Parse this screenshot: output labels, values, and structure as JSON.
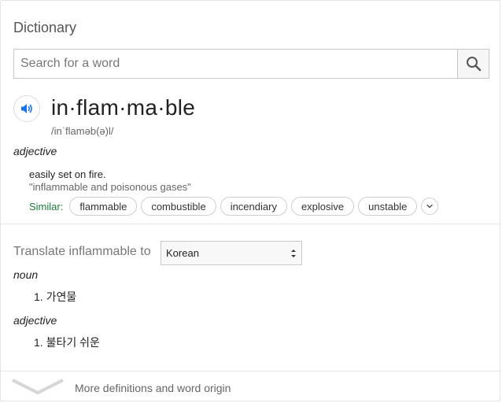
{
  "panel": {
    "title": "Dictionary"
  },
  "search": {
    "placeholder": "Search for a word"
  },
  "entry": {
    "headword": "in·flam·ma·ble",
    "phonetic": "/inˈflaməb(ə)l/",
    "part_of_speech": "adjective",
    "definition": "easily set on fire.",
    "example": "\"inflammable and poisonous gases\"",
    "similar_label": "Similar:",
    "similar": [
      "flammable",
      "combustible",
      "incendiary",
      "explosive",
      "unstable"
    ]
  },
  "translate": {
    "label": "Translate inflammable to",
    "language": "Korean",
    "groups": [
      {
        "pos": "noun",
        "items": [
          "1. 가연물"
        ]
      },
      {
        "pos": "adjective",
        "items": [
          "1. 불타기 쉬운"
        ]
      }
    ]
  },
  "footer": {
    "more_label": "More definitions and word origin"
  },
  "colors": {
    "similar_label": "#1b7f3b",
    "speaker_icon": "#1a73e8",
    "muted_text": "#777777"
  },
  "icons": [
    "search-icon",
    "speaker-icon",
    "chevron-down-icon",
    "select-arrows-icon"
  ]
}
